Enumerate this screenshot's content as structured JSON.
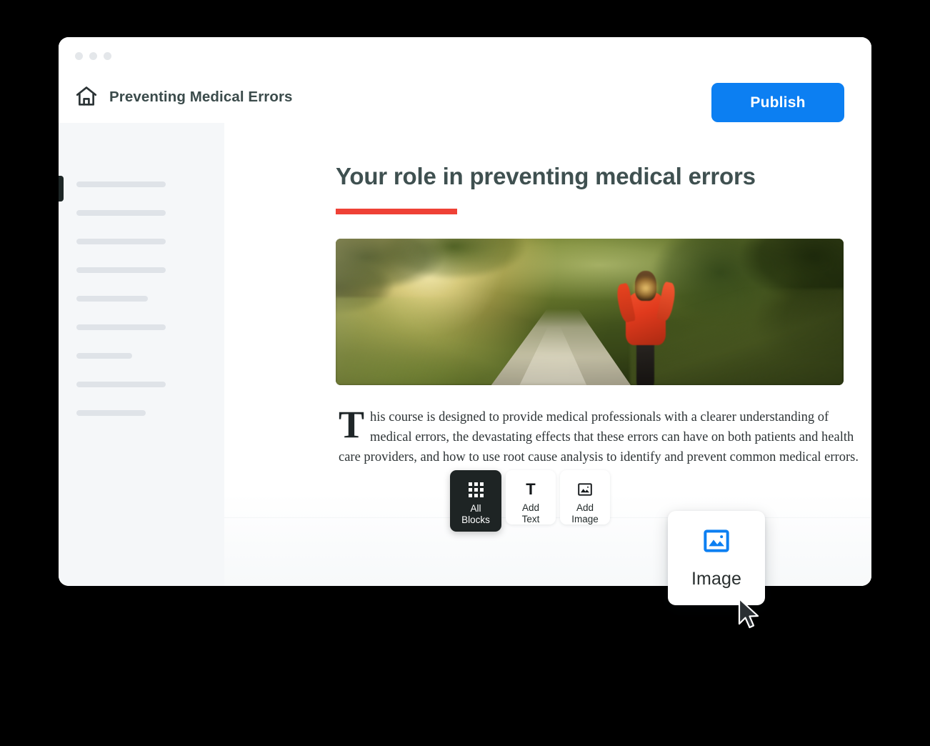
{
  "window": {
    "traffic_dots": 3
  },
  "header": {
    "home_icon": "home-icon",
    "title": "Preventing Medical Errors",
    "publish_label": "Publish",
    "publish_color": "#0c7ff2"
  },
  "sidebar": {
    "active_tab_indicator": true,
    "skeleton_widths": [
      125,
      125,
      125,
      125,
      100,
      125,
      78,
      125,
      97
    ]
  },
  "content": {
    "heading": "Your role in preventing medical errors",
    "heading_color": "#3f5050",
    "rule_color": "#ef4136",
    "hero_image_alt": "Person in red top walking along a sunlit tree-lined country path",
    "paragraph_dropcap": "T",
    "paragraph": "his course is designed to provide medical professionals with a clearer understanding of medical errors, the devastating effects that these errors can have on both patients and health care providers, and how to use root cause analysis to identify and prevent common medical errors."
  },
  "block_toolbar": {
    "buttons": [
      {
        "id": "all-blocks",
        "icon": "grid-icon",
        "line1": "All",
        "line2": "Blocks",
        "active": true
      },
      {
        "id": "add-text",
        "icon": "text-t-icon",
        "line1": "Add",
        "line2": "Text",
        "active": false
      },
      {
        "id": "add-image",
        "icon": "image-icon",
        "line1": "Add",
        "line2": "Image",
        "active": false
      }
    ]
  },
  "image_card": {
    "icon": "image-icon",
    "icon_color": "#0c7ff2",
    "label": "Image"
  },
  "cursor": {
    "icon": "arrow-pointer-icon"
  }
}
